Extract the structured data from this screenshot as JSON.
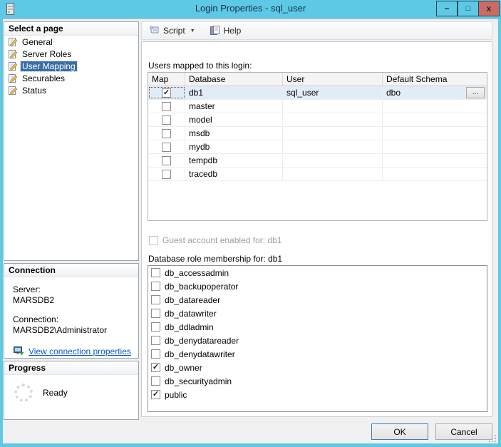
{
  "window": {
    "title": "Login Properties - sql_user"
  },
  "icons": {
    "window": "server-icon",
    "minimize": "−",
    "maximize": "□",
    "close": "x",
    "script_dropdown": "▼",
    "check": "✓",
    "ellipsis": "..."
  },
  "toolbar": {
    "script_label": "Script",
    "help_label": "Help"
  },
  "sidebar": {
    "select_page": {
      "header": "Select a page",
      "items": [
        {
          "label": "General",
          "selected": false
        },
        {
          "label": "Server Roles",
          "selected": false
        },
        {
          "label": "User Mapping",
          "selected": true
        },
        {
          "label": "Securables",
          "selected": false
        },
        {
          "label": "Status",
          "selected": false
        }
      ]
    },
    "connection": {
      "header": "Connection",
      "server_label": "Server:",
      "server_value": "MARSDB2",
      "connection_label": "Connection:",
      "connection_value": "MARSDB2\\Administrator",
      "link_label": "View connection properties"
    },
    "progress": {
      "header": "Progress",
      "status": "Ready"
    }
  },
  "main": {
    "mapping_label": "Users mapped to this login:",
    "table": {
      "columns": [
        "Map",
        "Database",
        "User",
        "Default Schema"
      ],
      "rows": [
        {
          "map": true,
          "database": "db1",
          "user": "sql_user",
          "default_schema": "dbo",
          "selected": true,
          "has_ellipsis": true
        },
        {
          "map": false,
          "database": "master",
          "user": "",
          "default_schema": "",
          "selected": false,
          "has_ellipsis": false
        },
        {
          "map": false,
          "database": "model",
          "user": "",
          "default_schema": "",
          "selected": false,
          "has_ellipsis": false
        },
        {
          "map": false,
          "database": "msdb",
          "user": "",
          "default_schema": "",
          "selected": false,
          "has_ellipsis": false
        },
        {
          "map": false,
          "database": "mydb",
          "user": "",
          "default_schema": "",
          "selected": false,
          "has_ellipsis": false
        },
        {
          "map": false,
          "database": "tempdb",
          "user": "",
          "default_schema": "",
          "selected": false,
          "has_ellipsis": false
        },
        {
          "map": false,
          "database": "tracedb",
          "user": "",
          "default_schema": "",
          "selected": false,
          "has_ellipsis": false
        }
      ]
    },
    "guest_checkbox": {
      "label": "Guest account enabled for: db1",
      "checked": false,
      "disabled": true
    },
    "roles_label": "Database role membership for: db1",
    "roles": [
      {
        "name": "db_accessadmin",
        "checked": false
      },
      {
        "name": "db_backupoperator",
        "checked": false
      },
      {
        "name": "db_datareader",
        "checked": false
      },
      {
        "name": "db_datawriter",
        "checked": false
      },
      {
        "name": "db_ddladmin",
        "checked": false
      },
      {
        "name": "db_denydatareader",
        "checked": false
      },
      {
        "name": "db_denydatawriter",
        "checked": false
      },
      {
        "name": "db_owner",
        "checked": true
      },
      {
        "name": "db_securityadmin",
        "checked": false
      },
      {
        "name": "public",
        "checked": true
      }
    ]
  },
  "footer": {
    "ok_label": "OK",
    "cancel_label": "Cancel"
  },
  "colors": {
    "titlebar": "#5ec9e4",
    "close_button": "#cd6a62",
    "selection_blue": "#3a6ea5",
    "row_highlight": "#e2ecf6",
    "link_blue": "#0a5bc4",
    "disabled_text": "#9e9e9e"
  }
}
